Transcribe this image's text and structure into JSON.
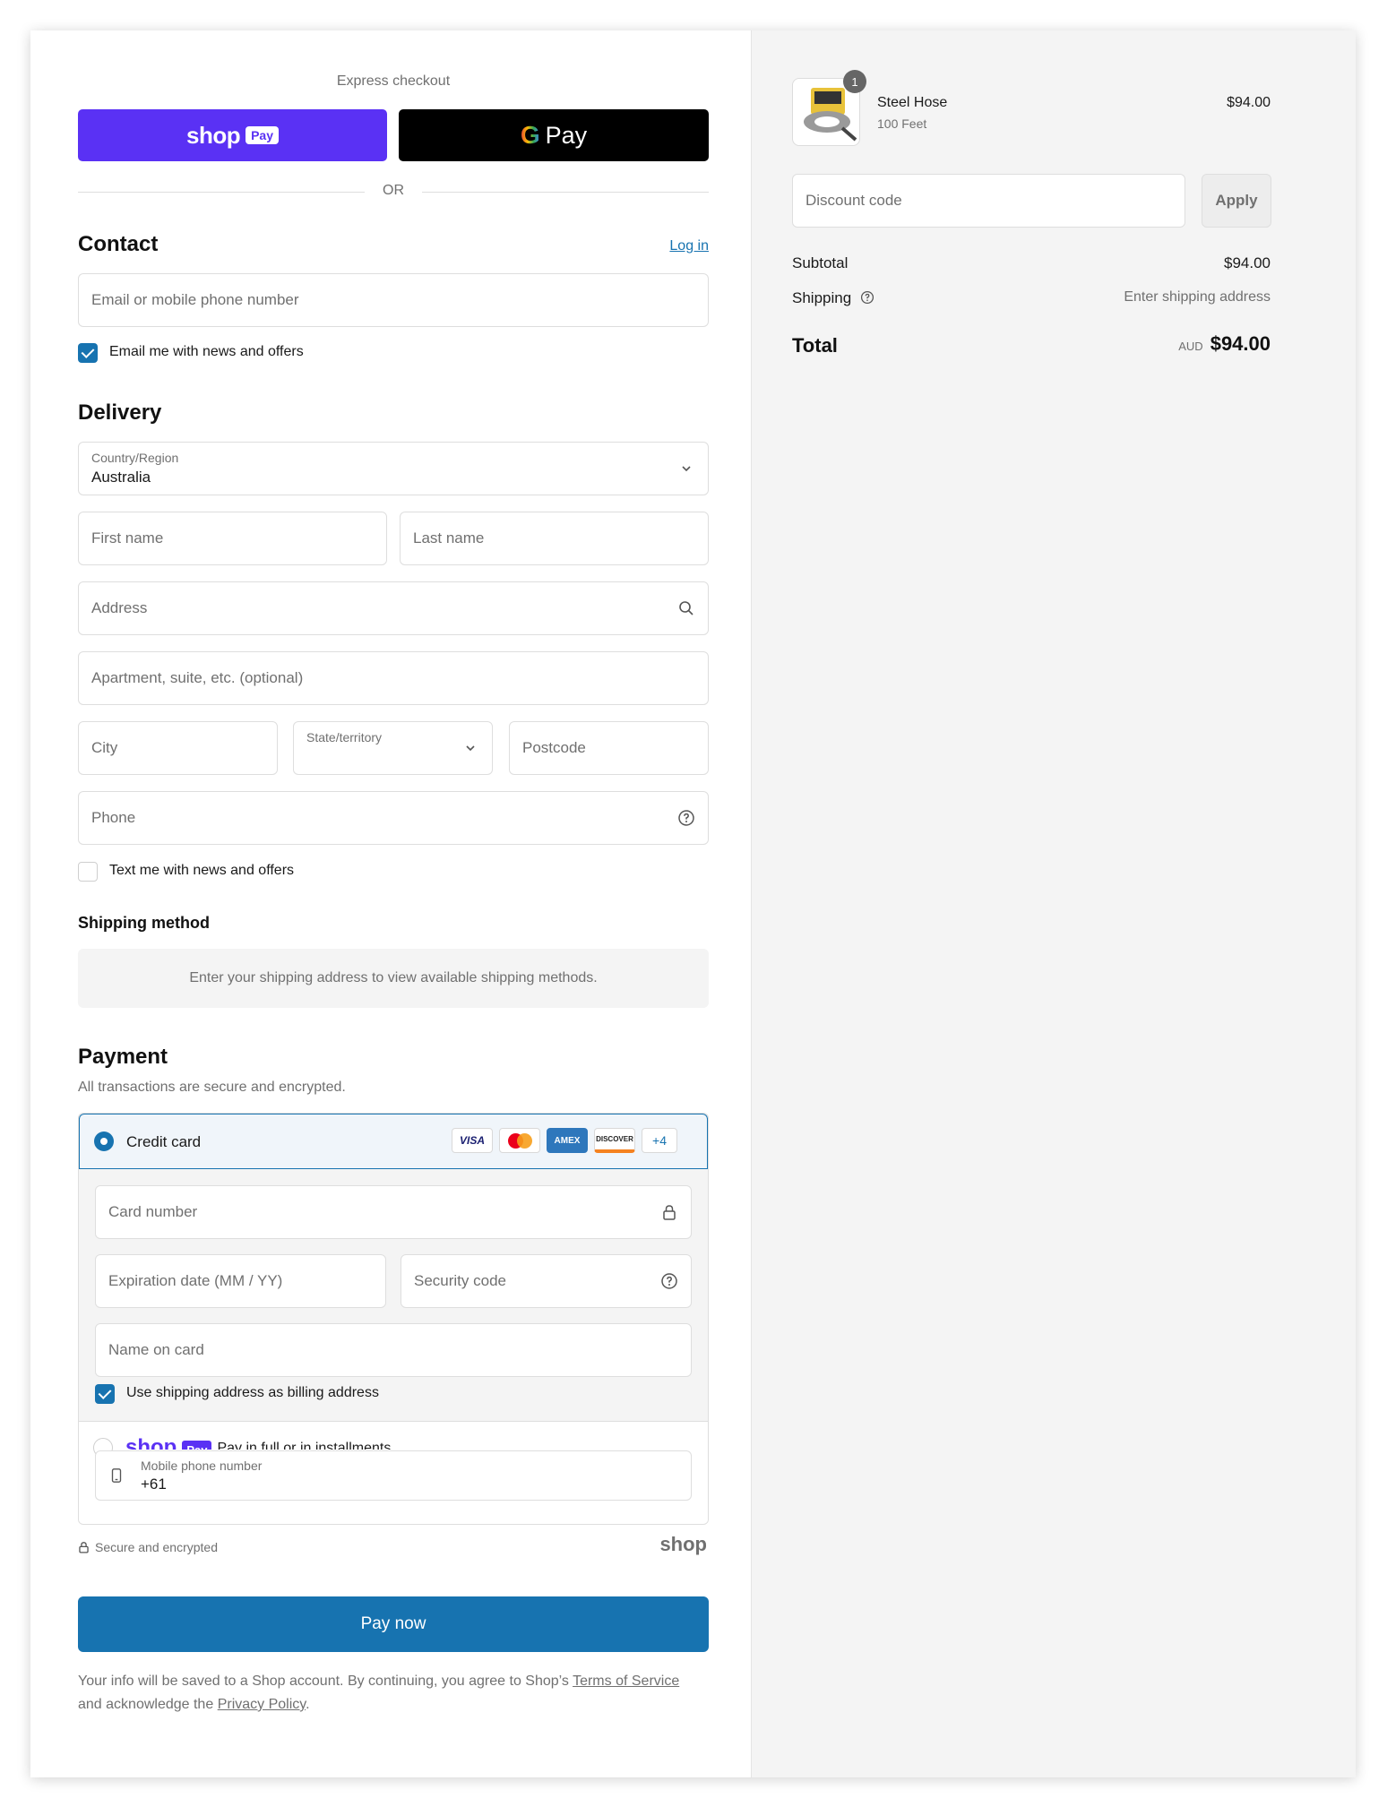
{
  "express": {
    "title": "Express checkout",
    "shop_pay": {
      "word": "shop",
      "badge": "Pay"
    },
    "gpay": {
      "g": "G",
      "word": "Pay"
    },
    "or": "OR"
  },
  "contact": {
    "heading": "Contact",
    "login": "Log in",
    "email_placeholder": "Email or mobile phone number",
    "news_label": "Email me with news and offers",
    "news_checked": true
  },
  "delivery": {
    "heading": "Delivery",
    "country_label": "Country/Region",
    "country_value": "Australia",
    "first_name": "First name",
    "last_name": "Last name",
    "address": "Address",
    "apartment": "Apartment, suite, etc. (optional)",
    "city": "City",
    "state": "State/territory",
    "postcode": "Postcode",
    "phone": "Phone",
    "text_label": "Text me with news and offers",
    "text_checked": false
  },
  "shipping_method": {
    "heading": "Shipping method",
    "message": "Enter your shipping address to view available shipping methods."
  },
  "payment": {
    "heading": "Payment",
    "subtitle": "All transactions are secure and encrypted.",
    "credit_card_label": "Credit card",
    "card_brands": [
      "VISA",
      "Mastercard",
      "AMEX",
      "DISCOVER",
      "+4"
    ],
    "card_number": "Card number",
    "expiration": "Expiration date (MM / YY)",
    "security_code": "Security code",
    "name_on_card": "Name on card",
    "billing_label": "Use shipping address as billing address",
    "billing_checked": true,
    "shop_pay_option": "Pay in full or in installments",
    "shop_pay_word": "shop",
    "shop_pay_badge": "Pay",
    "mobile_label": "Mobile phone number",
    "mobile_value": "+61",
    "secure_note": "Secure and encrypted",
    "shop_logo": "shop"
  },
  "pay_now": "Pay now",
  "footer": {
    "text_before": "Your info will be saved to a Shop account. By continuing, you agree to Shop’s",
    "terms": "Terms of Service",
    "text_mid": "and acknowledge the",
    "privacy": "Privacy Policy",
    "end": "."
  },
  "summary": {
    "item": {
      "name": "Steel Hose",
      "variant": "100 Feet",
      "price": "$94.00",
      "quantity": "1"
    },
    "discount_placeholder": "Discount code",
    "apply": "Apply",
    "subtotal_label": "Subtotal",
    "subtotal_value": "$94.00",
    "shipping_label": "Shipping",
    "shipping_value": "Enter shipping address",
    "total_label": "Total",
    "currency": "AUD",
    "total_value": "$94.00"
  },
  "colors": {
    "accent": "#1773b0",
    "shop_purple": "#5a31f4",
    "summary_bg": "#f4f4f4"
  }
}
